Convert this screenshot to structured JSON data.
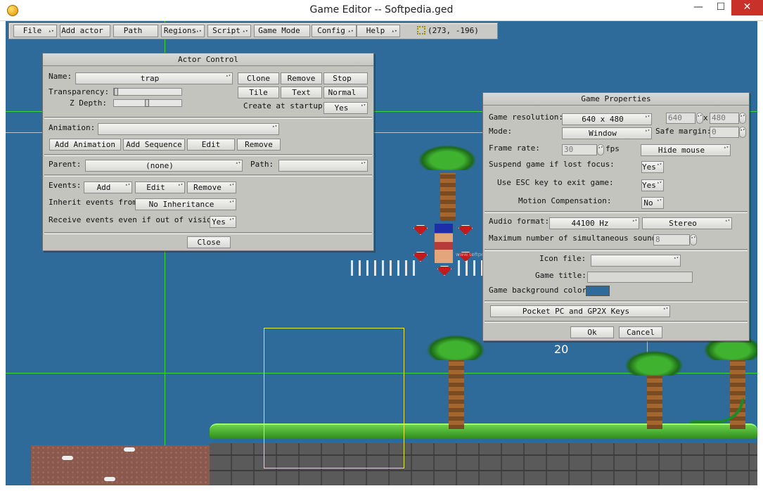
{
  "window": {
    "title": "Game Editor -- Softpedia.ged",
    "min_label": "—",
    "max_label": "☐",
    "close_label": "✕"
  },
  "menubar": {
    "items": [
      "File",
      "Add actor",
      "Path",
      "Regions",
      "Script",
      "Game Mode",
      "Config",
      "Help"
    ],
    "coords": "(273, -196)"
  },
  "canvas": {
    "score": "20",
    "watermark": "www.softpedia.com"
  },
  "actor_control": {
    "title": "Actor Control",
    "name_label": "Name:",
    "name_value": "trap",
    "clone": "Clone",
    "remove": "Remove",
    "stop": "Stop",
    "tile": "Tile",
    "text": "Text",
    "normal": "Normal",
    "transparency_label": "Transparency:",
    "transparency": 0.0,
    "zdepth_label": "Z Depth:",
    "zdepth": 0.5,
    "create_startup_label": "Create at startup:",
    "create_startup_value": "Yes",
    "animation_label": "Animation:",
    "animation_value": "",
    "add_animation": "Add Animation",
    "add_sequence": "Add Sequence",
    "anim_edit": "Edit",
    "anim_remove": "Remove",
    "parent_label": "Parent:",
    "parent_value": "(none)",
    "path_label": "Path:",
    "path_value": "",
    "events_label": "Events:",
    "events_add": "Add",
    "events_edit": "Edit",
    "events_remove": "Remove",
    "inherit_label": "Inherit events from:",
    "inherit_value": "No Inheritance",
    "receive_label": "Receive events even if out of vision:",
    "receive_value": "Yes",
    "close": "Close"
  },
  "game_properties": {
    "title": "Game Properties",
    "resolution_label": "Game resolution:",
    "resolution_value": "640 x 480",
    "res_w": "640",
    "res_x": "x",
    "res_h": "480",
    "mode_label": "Mode:",
    "mode_value": "Window",
    "safe_margin_label": "Safe margin:",
    "safe_margin_value": "0",
    "frame_rate_label": "Frame rate:",
    "frame_rate_value": "30",
    "fps": "fps",
    "hide_mouse": "Hide mouse",
    "suspend_label": "Suspend game if lost focus:",
    "suspend_value": "Yes",
    "esc_label": "Use ESC key to exit game:",
    "esc_value": "Yes",
    "motion_label": "Motion Compensation:",
    "motion_value": "No",
    "audio_label": "Audio format:",
    "audio_rate": "44100 Hz",
    "audio_channels": "Stereo",
    "sounds_label": "Maximum number of simultaneous sounds:",
    "sounds_value": "8",
    "icon_label": "Icon file:",
    "icon_value": "",
    "game_title_label": "Game title:",
    "game_title_value": "",
    "bg_color_label": "Game background color:",
    "bg_color": "#2f6b9a",
    "pocket_pc": "Pocket PC and GP2X Keys",
    "ok": "Ok",
    "cancel": "Cancel"
  }
}
